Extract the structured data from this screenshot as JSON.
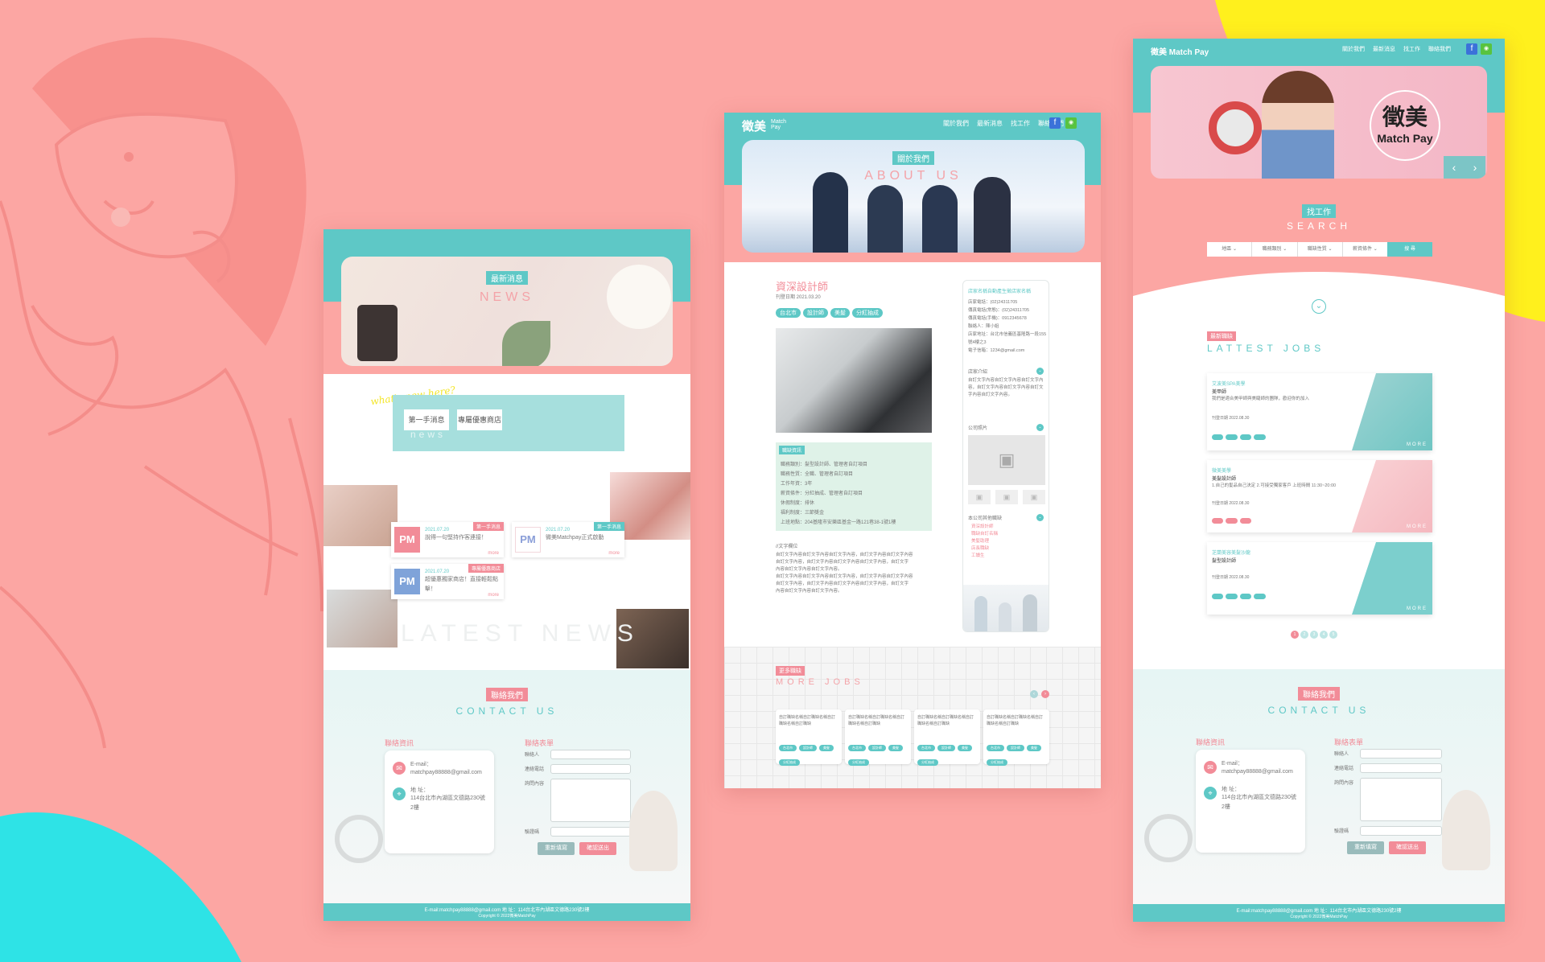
{
  "colors": {
    "background": "#fca6a3",
    "teal": "#5ec8c6",
    "pink": "#f28c98",
    "yellow": "#fff01d",
    "cyan": "#2ee3e6"
  },
  "left_mock": {
    "hero_badge": "最新消息",
    "hero_en": "NEWS",
    "script_text": "what's new here?",
    "tabs": [
      "第一手消息",
      "專屬優惠商店"
    ],
    "tab_ghost": "news",
    "news": [
      {
        "date": "2021.07.20",
        "tag": "第一手消息",
        "title": "說得一句堅持作客連接！",
        "more": "more"
      },
      {
        "date": "2021.07.20",
        "tag": "第一手消息",
        "title": "微美Matchpay正式啟動",
        "more": "more"
      },
      {
        "date": "2021.07.20",
        "tag": "專屬優惠商店",
        "title": "超優惠獨家商店！直接輕鬆點擊！",
        "more": "more"
      }
    ],
    "latest_ghost": "LATEST NEWS",
    "contact_badge": "聯絡我們",
    "contact_en": "CONTACT US",
    "info_title": "聯絡資訊",
    "form_title": "聯絡表單",
    "email_label": "E-mail：",
    "email": "matchpay88888@gmail.com",
    "address_label": "地 址：",
    "address": "114台北市內湖區文德路230號2樓",
    "fields": [
      "聯絡人",
      "連絡電話",
      "詢問內容",
      "驗證碼"
    ],
    "btn_reset": "重新填寫",
    "btn_submit": "確認送出",
    "footer": "E-mail:matchpay88888@gmail.com  地 址：114台北市內湖區文德路230號2樓",
    "copyright": "Copyright © 2022微美MatchPay"
  },
  "center_mock": {
    "logo": "徵美",
    "logo_sub": "Match Pay",
    "nav": [
      "關於我們",
      "最新消息",
      "找工作",
      "聯絡我們"
    ],
    "hero_badge": "關於我們",
    "hero_en": "ABOUT US",
    "job_title": "資深設計師",
    "job_date": "刊登日期 2021.03.20",
    "job_tags": [
      "台北市",
      "設計師",
      "美髮",
      "分紅抽成"
    ],
    "detail_badge": "職缺資訊",
    "detail_lines": [
      "職務類別：髮型設計師、管理者自訂項目",
      "職務性質：全職、管理者自訂項目",
      "工作年資：3年",
      "薪資條件：分紅抽成、管理者自訂項目",
      "休假制度：排休",
      "福利制度：三節獎金",
      "上班地點：204基隆市安樂區基金一路121巷38-1號1樓"
    ],
    "desc_title": "//文字欄位",
    "desc_lines": [
      "自訂文字內容自訂文字內容自訂文字內容，自訂文字內容自訂文字內容",
      "自訂文字內容，自訂文字內容自訂文字內容自訂文字內容，自訂文字",
      "內容自訂文字內容自訂文字內容。",
      "自訂文字內容自訂文字內容自訂文字內容，自訂文字內容自訂文字內容",
      "自訂文字內容，自訂文字內容自訂文字內容自訂文字內容，自訂文字",
      "內容自訂文字內容自訂文字內容。"
    ],
    "company_name": "店家名稱自動產生徵店家名稱",
    "company_lines": [
      "店家電話：(02)24311705",
      "傳真電話(常態)：(02)24311705",
      "傳真電話(手機)：0912345678",
      "聯絡人：陳小姐",
      "店家地址：台北市信義區基隆路一段155號4樓之3",
      "電子信箱：1234@gmail.com"
    ],
    "side_sections": [
      "店家介紹",
      "公司照片",
      "本公司其他職缺"
    ],
    "side_intro": "自訂文字內容自訂文字內容自訂文字內容，自訂文字內容自訂文字內容自訂文字內容自訂文字內容。",
    "other_jobs": [
      "資深設計師",
      "職缺自訂名稱",
      "美髮助理",
      "店長職缺",
      "工讀生"
    ],
    "more_badge": "更多職缺",
    "more_en": "MORE JOBS",
    "more_card_text": "自訂職缺名稱自訂職缺名稱自訂職缺名稱自訂職缺",
    "more_card_tags": [
      "台北市",
      "設計師",
      "美髮",
      "分紅抽成"
    ]
  },
  "right_mock": {
    "logo": "徵美 Match Pay",
    "nav": [
      "關於我們",
      "最新消息",
      "找工作",
      "聯絡我們"
    ],
    "banner_brand": "徵美",
    "banner_brand_sub": "Match Pay",
    "search_badge": "找工作",
    "search_en": "SEARCH",
    "search_fields": [
      "地區",
      "職務類別",
      "職缺性質",
      "薪資條件"
    ],
    "search_btn": "搜 尋",
    "latest_badge": "最新職缺",
    "latest_en": "LATTEST JOBS",
    "jobs": [
      {
        "shop": "艾波美SPA美學",
        "title": "美甲師",
        "desc": "我們是適合美甲師與美睫師的團隊，歡迎你的加入",
        "date": "刊登日期 2022.08.30",
        "more": "MORE"
      },
      {
        "shop": "微美美學",
        "title": "美髮設計師",
        "desc": "1.自己的髮品自己決定 2.可接受獨家客戶 上班時間 11:30~20:00",
        "date": "刊登日期 2022.08.30",
        "more": "MORE"
      },
      {
        "shop": "芝蘭美容美髮沙龍",
        "title": "髮型設計師",
        "desc": "",
        "date": "刊登日期 2022.08.30",
        "more": "MORE"
      }
    ],
    "pages": [
      "1",
      "2",
      "3",
      "4",
      "5"
    ],
    "contact_badge": "聯絡我們",
    "contact_en": "CONTACT US",
    "info_title": "聯絡資訊",
    "form_title": "聯絡表單",
    "email_label": "E-mail：",
    "email": "matchpay88888@gmail.com",
    "address_label": "地 址：",
    "address": "114台北市內湖區文德路230號2樓",
    "fields": [
      "聯絡人",
      "連絡電話",
      "詢問內容",
      "驗證碼"
    ],
    "btn_reset": "重新填寫",
    "btn_submit": "確認送出",
    "footer": "E-mail:matchpay88888@gmail.com  地 址：114台北市內湖區文德路230號2樓",
    "copyright": "Copyright © 2022微美MatchPay"
  }
}
